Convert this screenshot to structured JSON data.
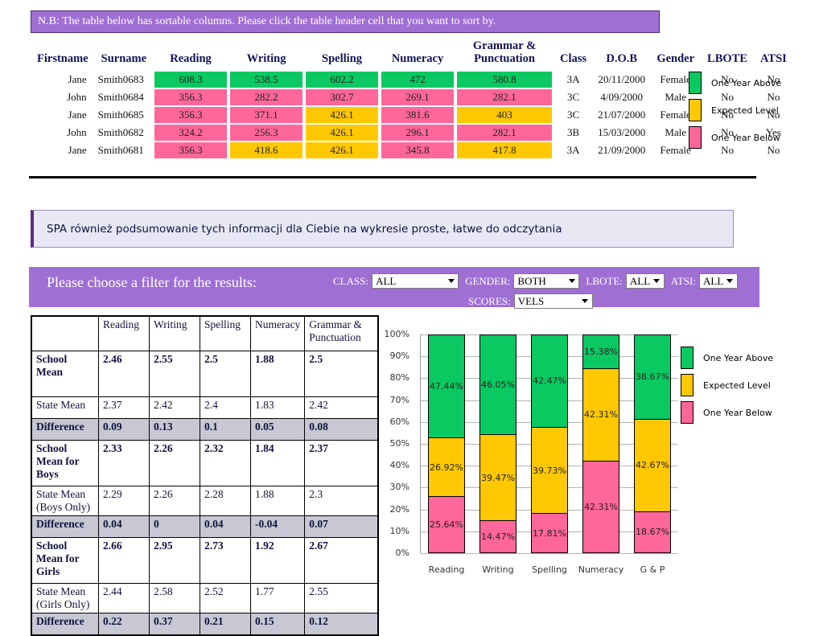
{
  "notice": {
    "text": "N.B: The table below has sortable columns. Please click the table header cell that you want to sort by."
  },
  "students_table": {
    "headers": [
      "Firstname",
      "Surname",
      "Reading",
      "Writing",
      "Spelling",
      "Numeracy",
      "Grammar & Punctuation",
      "Class",
      "D.O.B",
      "Gender",
      "LBOTE",
      "ATSI"
    ],
    "header_grammar_line1": "Grammar &",
    "header_grammar_line2": "Punctuation",
    "rows": [
      {
        "firstname": "Jane",
        "surname": "Smith0683",
        "reading": "608.3",
        "reading_level": "above",
        "writing": "538.5",
        "writing_level": "above",
        "spelling": "602.2",
        "spelling_level": "above",
        "numeracy": "472",
        "numeracy_level": "above",
        "grammar": "580.8",
        "grammar_level": "above",
        "class": "3A",
        "dob": "20/11/2000",
        "gender": "Female",
        "lbote": "No",
        "atsi": "No"
      },
      {
        "firstname": "John",
        "surname": "Smith0684",
        "reading": "356.3",
        "reading_level": "below",
        "writing": "282.2",
        "writing_level": "below",
        "spelling": "302.7",
        "spelling_level": "below",
        "numeracy": "269.1",
        "numeracy_level": "below",
        "grammar": "282.1",
        "grammar_level": "below",
        "class": "3C",
        "dob": "4/09/2000",
        "gender": "Male",
        "lbote": "No",
        "atsi": "No"
      },
      {
        "firstname": "Jane",
        "surname": "Smith0685",
        "reading": "356.3",
        "reading_level": "below",
        "writing": "371.1",
        "writing_level": "below",
        "spelling": "426.1",
        "spelling_level": "expect",
        "numeracy": "381.6",
        "numeracy_level": "below",
        "grammar": "403",
        "grammar_level": "expect",
        "class": "3C",
        "dob": "21/07/2000",
        "gender": "Female",
        "lbote": "No",
        "atsi": "No"
      },
      {
        "firstname": "John",
        "surname": "Smith0682",
        "reading": "324.2",
        "reading_level": "below",
        "writing": "256.3",
        "writing_level": "below",
        "spelling": "426.1",
        "spelling_level": "expect",
        "numeracy": "296.1",
        "numeracy_level": "below",
        "grammar": "282.1",
        "grammar_level": "below",
        "class": "3B",
        "dob": "15/03/2000",
        "gender": "Male",
        "lbote": "No",
        "atsi": "Yes"
      },
      {
        "firstname": "Jane",
        "surname": "Smith0681",
        "reading": "356.3",
        "reading_level": "below",
        "writing": "418.6",
        "writing_level": "expect",
        "spelling": "426.1",
        "spelling_level": "expect",
        "numeracy": "345.8",
        "numeracy_level": "below",
        "grammar": "417.8",
        "grammar_level": "expect",
        "class": "3A",
        "dob": "21/09/2000",
        "gender": "Female",
        "lbote": "No",
        "atsi": "No"
      }
    ]
  },
  "legend": {
    "items": [
      {
        "label": "One Year Above",
        "color": "#0ac961",
        "key": "above"
      },
      {
        "label": "Expected Level",
        "color": "#ffc800",
        "key": "expect"
      },
      {
        "label": "One Year Below",
        "color": "#ff6699",
        "key": "below"
      }
    ]
  },
  "info_box": {
    "text": "SPA również podsumowanie tych informacji dla Ciebie na wykresie proste, łatwe do odczytania"
  },
  "filter_bar": {
    "title": "Please choose a filter for the results:",
    "selects": [
      {
        "label": "CLASS:",
        "value": "ALL"
      },
      {
        "label": "GENDER:",
        "value": "BOTH"
      },
      {
        "label": "LBOTE:",
        "value": "ALL"
      },
      {
        "label": "ATSI:",
        "value": "ALL"
      },
      {
        "label": "SCORES:",
        "value": "VELS"
      }
    ]
  },
  "summary_table": {
    "columns": [
      "Reading",
      "Writing",
      "Spelling",
      "Numeracy",
      "Grammar & Punctuation"
    ],
    "col_gp_line1": "Grammar &",
    "col_gp_line2": "Punctuation",
    "rows": [
      {
        "label": "School Mean",
        "values": [
          "2.46",
          "2.55",
          "2.5",
          "1.88",
          "2.5"
        ],
        "style": "bold",
        "size": "tall"
      },
      {
        "label": "State Mean",
        "values": [
          "2.37",
          "2.42",
          "2.4",
          "1.83",
          "2.42"
        ],
        "style": "normal",
        "size": "small"
      },
      {
        "label": "Difference",
        "values": [
          "0.09",
          "0.13",
          "0.1",
          "0.05",
          "0.08"
        ],
        "style": "diff",
        "size": "small"
      },
      {
        "label": "School Mean for Boys",
        "values": [
          "2.33",
          "2.26",
          "2.32",
          "1.84",
          "2.37"
        ],
        "style": "bold",
        "size": "tall"
      },
      {
        "label": "State Mean (Boys Only)",
        "values": [
          "2.29",
          "2.26",
          "2.28",
          "1.88",
          "2.3"
        ],
        "style": "normal",
        "size": "mid"
      },
      {
        "label": "Difference",
        "values": [
          "0.04",
          "0",
          "0.04",
          "-0.04",
          "0.07"
        ],
        "style": "diff",
        "size": "small"
      },
      {
        "label": "School Mean for Girls",
        "values": [
          "2.66",
          "2.95",
          "2.73",
          "1.92",
          "2.67"
        ],
        "style": "bold",
        "size": "tall"
      },
      {
        "label": "State Mean (Girls Only)",
        "values": [
          "2.44",
          "2.58",
          "2.52",
          "1.77",
          "2.55"
        ],
        "style": "normal",
        "size": "mid"
      },
      {
        "label": "Difference",
        "values": [
          "0.22",
          "0.37",
          "0.21",
          "0.15",
          "0.12"
        ],
        "style": "diff",
        "size": "small"
      }
    ]
  },
  "chart_data": {
    "type": "bar",
    "stacked": true,
    "title": "",
    "xlabel": "",
    "ylabel": "",
    "ylim": [
      0,
      100
    ],
    "yticks": [
      "0%",
      "10%",
      "20%",
      "30%",
      "40%",
      "50%",
      "60%",
      "70%",
      "80%",
      "90%",
      "100%"
    ],
    "grid": true,
    "legend_position": "right",
    "categories": [
      "Reading",
      "Writing",
      "Spelling",
      "Numeracy",
      "G & P"
    ],
    "series": [
      {
        "name": "One Year Below",
        "color": "#ff6699",
        "values": [
          25.64,
          14.47,
          17.81,
          42.31,
          18.67
        ],
        "labels": [
          "25.64%",
          "14.47%",
          "17.81%",
          "42.31%",
          "18.67%"
        ]
      },
      {
        "name": "Expected Level",
        "color": "#ffc800",
        "values": [
          26.92,
          39.47,
          39.73,
          42.31,
          42.67
        ],
        "labels": [
          "26.92%",
          "39.47%",
          "39.73%",
          "42.31%",
          "42.67%"
        ]
      },
      {
        "name": "One Year Above",
        "color": "#0ac961",
        "values": [
          47.44,
          46.05,
          42.47,
          15.38,
          38.67
        ],
        "labels": [
          "47.44%",
          "46.05%",
          "42.47%",
          "15.38%",
          "38.67%"
        ]
      }
    ]
  }
}
